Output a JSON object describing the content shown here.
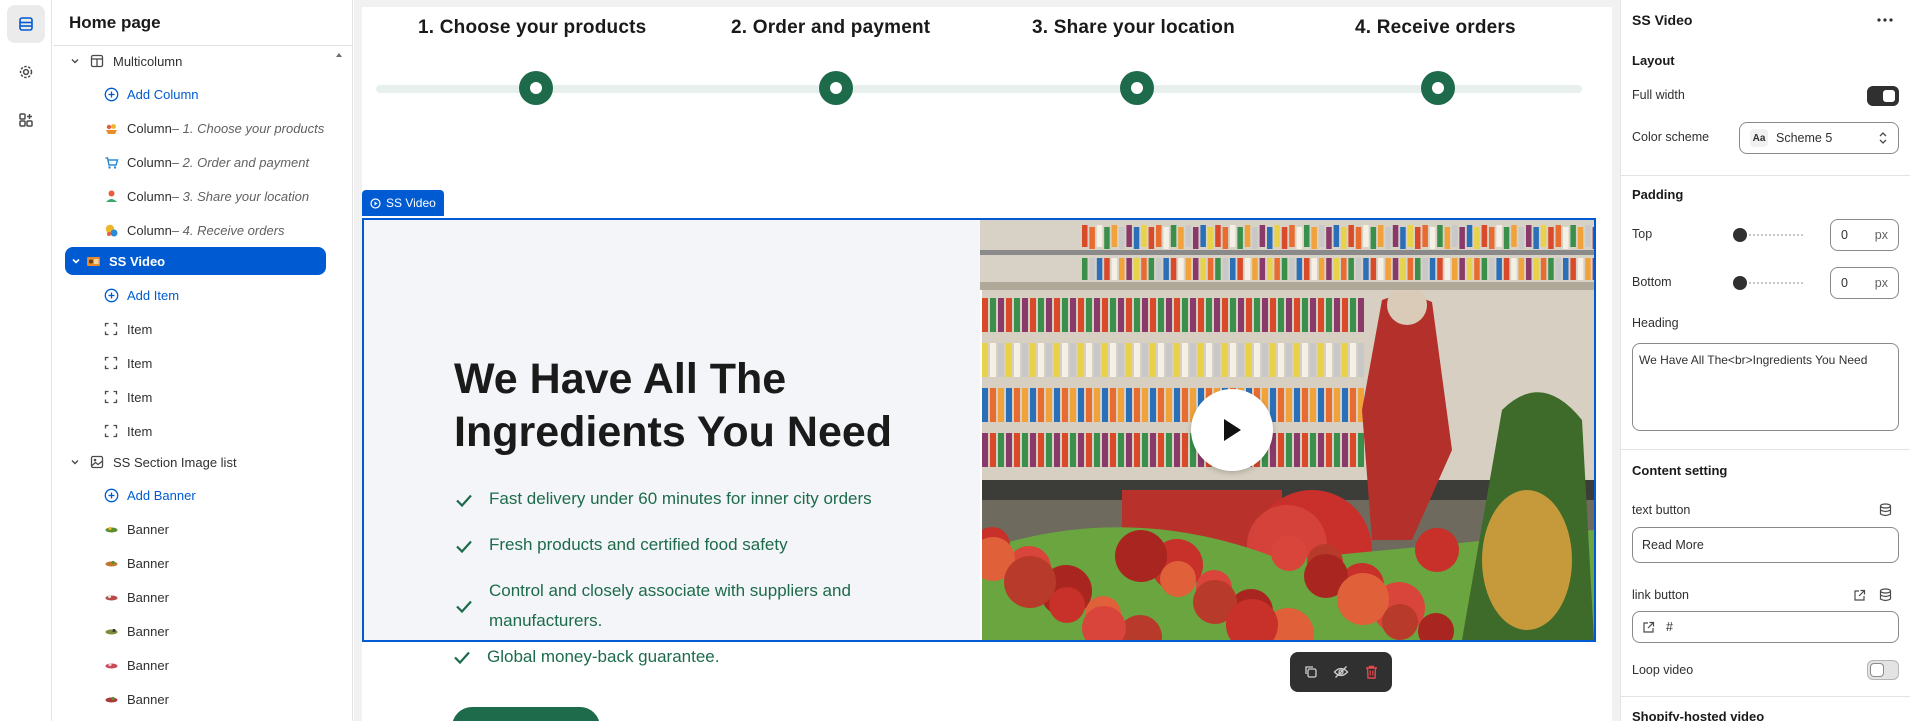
{
  "sidebar": {
    "title": "Home page",
    "items": [
      {
        "label": "Multicolumn",
        "sub": "",
        "icon": "multicolumn-icon"
      },
      {
        "label": "Add Column",
        "sub": "",
        "icon": "add-circle-icon"
      },
      {
        "label": "Column",
        "sub": " – 1. Choose your products",
        "icon": "column-thumbnail-icon"
      },
      {
        "label": "Column",
        "sub": " – 2. Order and payment",
        "icon": "column-thumbnail-icon"
      },
      {
        "label": "Column",
        "sub": " – 3. Share your location",
        "icon": "column-thumbnail-icon"
      },
      {
        "label": "Column",
        "sub": " – 4. Receive orders",
        "icon": "column-thumbnail-icon"
      },
      {
        "label": "SS Video",
        "sub": "",
        "icon": "video-section-icon"
      },
      {
        "label": "Add Item",
        "sub": "",
        "icon": "add-circle-icon"
      },
      {
        "label": "Item",
        "sub": "",
        "icon": "block-icon"
      },
      {
        "label": "Item",
        "sub": "",
        "icon": "block-icon"
      },
      {
        "label": "Item",
        "sub": "",
        "icon": "block-icon"
      },
      {
        "label": "Item",
        "sub": "",
        "icon": "block-icon"
      },
      {
        "label": "SS Section Image list",
        "sub": "",
        "icon": "image-list-icon"
      },
      {
        "label": "Add Banner",
        "sub": "",
        "icon": "add-circle-icon"
      },
      {
        "label": "Banner",
        "sub": "",
        "icon": "banner-thumbnail-icon"
      },
      {
        "label": "Banner",
        "sub": "",
        "icon": "banner-thumbnail-icon"
      },
      {
        "label": "Banner",
        "sub": "",
        "icon": "banner-thumbnail-icon"
      },
      {
        "label": "Banner",
        "sub": "",
        "icon": "banner-thumbnail-icon"
      },
      {
        "label": "Banner",
        "sub": "",
        "icon": "banner-thumbnail-icon"
      },
      {
        "label": "Banner",
        "sub": "",
        "icon": "banner-thumbnail-icon"
      }
    ]
  },
  "preview": {
    "steps": [
      "1. Choose your products",
      "2. Order and payment",
      "3. Share your location",
      "4. Receive orders"
    ],
    "section_tag": "SS Video",
    "heading_line1": "We Have All The",
    "heading_line2": "Ingredients You Need",
    "features": [
      "Fast delivery under 60 minutes for inner city orders",
      "Fresh products and certified food safety",
      "Control and closely associate with suppliers and",
      "manufacturers.",
      "Global money-back guarantee."
    ]
  },
  "panel": {
    "title": "SS Video",
    "layout_heading": "Layout",
    "full_width_label": "Full width",
    "full_width_on": true,
    "color_scheme_label": "Color scheme",
    "color_scheme_value": "Scheme 5",
    "swatch_text": "Aa",
    "padding_heading": "Padding",
    "top_label": "Top",
    "top_value": "0",
    "bottom_label": "Bottom",
    "bottom_value": "0",
    "unit": "px",
    "heading_label": "Heading",
    "heading_value": "We Have All The<br>Ingredients You Need",
    "content_heading": "Content setting",
    "text_button_label": "text button",
    "text_button_value": "Read More",
    "link_button_label": "link button",
    "link_button_value": "#",
    "loop_video_label": "Loop video",
    "loop_video_on": false,
    "shopify_video_label": "Shopify-hosted video"
  },
  "colors": {
    "accent": "#005bd3",
    "brand_green": "#1d6b4b",
    "text": "#303030"
  }
}
